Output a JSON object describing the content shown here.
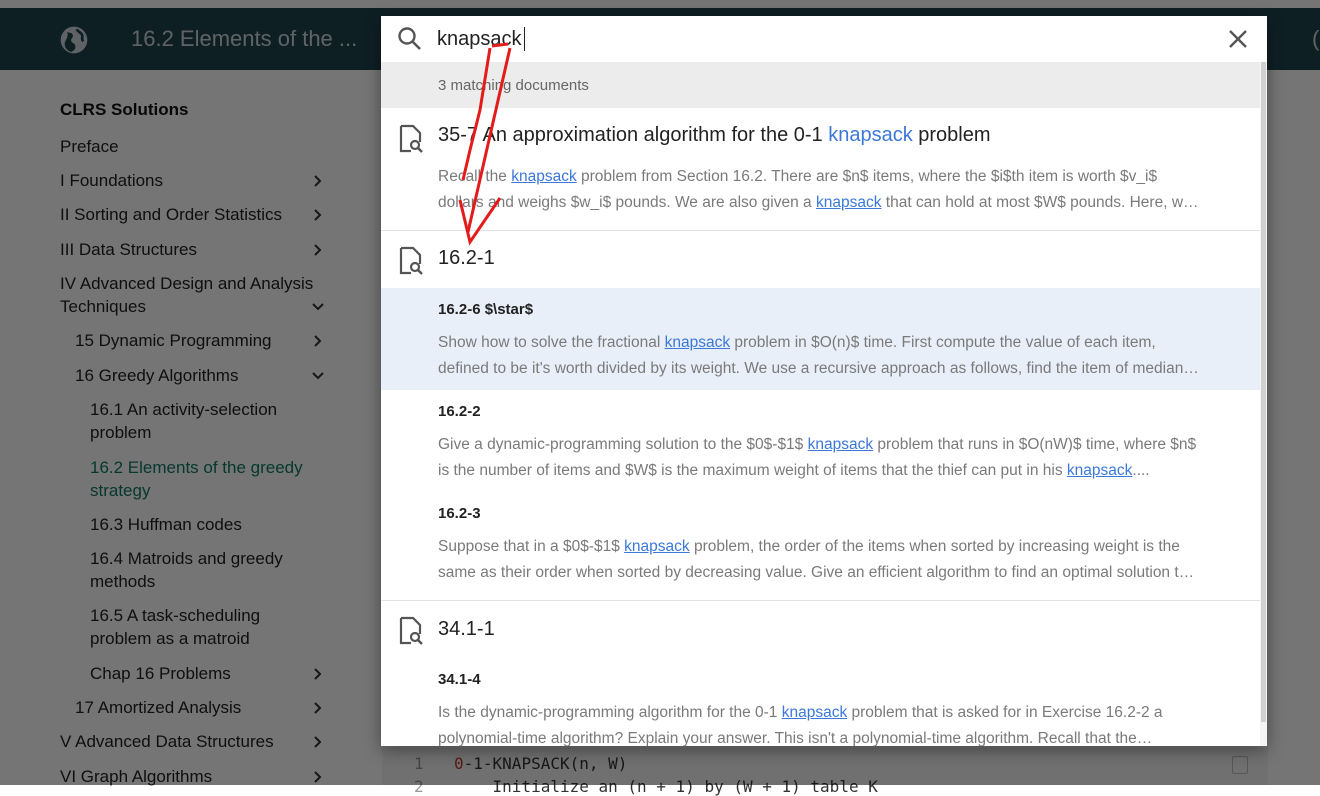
{
  "header": {
    "title": "16.2 Elements of the ...",
    "globe_icon": "globe-icon",
    "edge_glyph": "("
  },
  "sidebar": {
    "title": "CLRS Solutions",
    "items": [
      {
        "label": "Preface",
        "chevron": "none",
        "active": false
      },
      {
        "label": "I Foundations",
        "chevron": "right",
        "active": false
      },
      {
        "label": "II Sorting and Order Statistics",
        "chevron": "right",
        "active": false
      },
      {
        "label": "III Data Structures",
        "chevron": "right",
        "active": false
      },
      {
        "label_line1": "IV Advanced Design and Analysis",
        "label_line2": "Techniques",
        "chevron": "down",
        "active": false
      },
      {
        "label": "15 Dynamic Programming",
        "chevron": "right",
        "active": false
      },
      {
        "label": "16 Greedy Algorithms",
        "chevron": "down",
        "active": false
      },
      {
        "label_line1": "16.1 An activity-selection",
        "label_line2": "problem",
        "chevron": "none",
        "active": false
      },
      {
        "label_line1": "16.2 Elements of the greedy",
        "label_line2": "strategy",
        "chevron": "none",
        "active": true
      },
      {
        "label": "16.3 Huffman codes",
        "chevron": "none",
        "active": false
      },
      {
        "label_line1": "16.4 Matroids and greedy",
        "label_line2": "methods",
        "chevron": "none",
        "active": false
      },
      {
        "label_line1": "16.5 A task-scheduling",
        "label_line2": "problem as a matroid",
        "chevron": "none",
        "active": false
      },
      {
        "label": "Chap 16 Problems",
        "chevron": "right",
        "active": false
      },
      {
        "label": "17 Amortized Analysis",
        "chevron": "right",
        "active": false
      },
      {
        "label": "V Advanced Data Structures",
        "chevron": "right",
        "active": false
      },
      {
        "label": "VI Graph Algorithms",
        "chevron": "right",
        "active": false
      }
    ]
  },
  "code": {
    "line1_no": "1",
    "line2_no": "2",
    "line1_num": "0",
    "line1_rest": "-1-KNAPSACK(n, W)",
    "line2_text": "    Initialize an (n + 1) by (W + 1) table K"
  },
  "search": {
    "query": "knapsack",
    "meta": "3 matching documents",
    "results": [
      {
        "title_prefix": "35-7 An approximation algorithm for the 0-1 ",
        "title_highlight": "knapsack",
        "title_suffix": " problem",
        "snippet_line1_a": "Recall the ",
        "snippet_line1_link": "knapsack",
        "snippet_line1_b": " problem from Section 16.2. There are $n$ items, where the $i$th item is worth $v_i$",
        "snippet_line2_a": "dollars and weighs $w_i$ pounds. We are also given a ",
        "snippet_line2_link": "knapsack",
        "snippet_line2_b": " that can hold at most $W$ pounds. Here, w…"
      },
      {
        "title": "16.2-1",
        "subs": [
          {
            "title": "16.2-6 $\\star$",
            "line1_a": "Show how to solve the fractional ",
            "line1_link": "knapsack",
            "line1_b": " problem in $O(n)$ time. First compute the value of each item,",
            "line2": "defined to be it's worth divided by its weight. We use a recursive approach as follows, find the item of median…"
          },
          {
            "title": "16.2-2",
            "line1_a": "Give a dynamic-programming solution to the $0$-$1$ ",
            "line1_link": "knapsack",
            "line1_b": " problem that runs in $O(nW)$ time, where $n$",
            "line2_a": "is the number of items and $W$ is the maximum weight of items that the thief can put in his ",
            "line2_link": "knapsack",
            "line2_b": "...."
          },
          {
            "title": "16.2-3",
            "line1_a": "Suppose that in a $0$-$1$ ",
            "line1_link": "knapsack",
            "line1_b": " problem, the order of the items when sorted by increasing weight is the",
            "line2": "same as their order when sorted by decreasing value. Give an efficient algorithm to find an optimal solution t…"
          }
        ]
      },
      {
        "title": "34.1-1",
        "subs": [
          {
            "title": "34.1-4",
            "line1_a": "Is the dynamic-programming algorithm for the 0-1 ",
            "line1_link": "knapsack",
            "line1_b": " problem that is asked for in Exercise 16.2-2 a",
            "line2": "polynomial-time algorithm? Explain your answer. This isn't a polynomial-time algorithm. Recall that the…"
          }
        ]
      }
    ]
  },
  "colors": {
    "header_bg": "#1f4450",
    "active_link": "#0e7a63",
    "highlight": "#3b78d8",
    "annotation": "#e31b1b",
    "selected_row": "#e8eff9"
  }
}
